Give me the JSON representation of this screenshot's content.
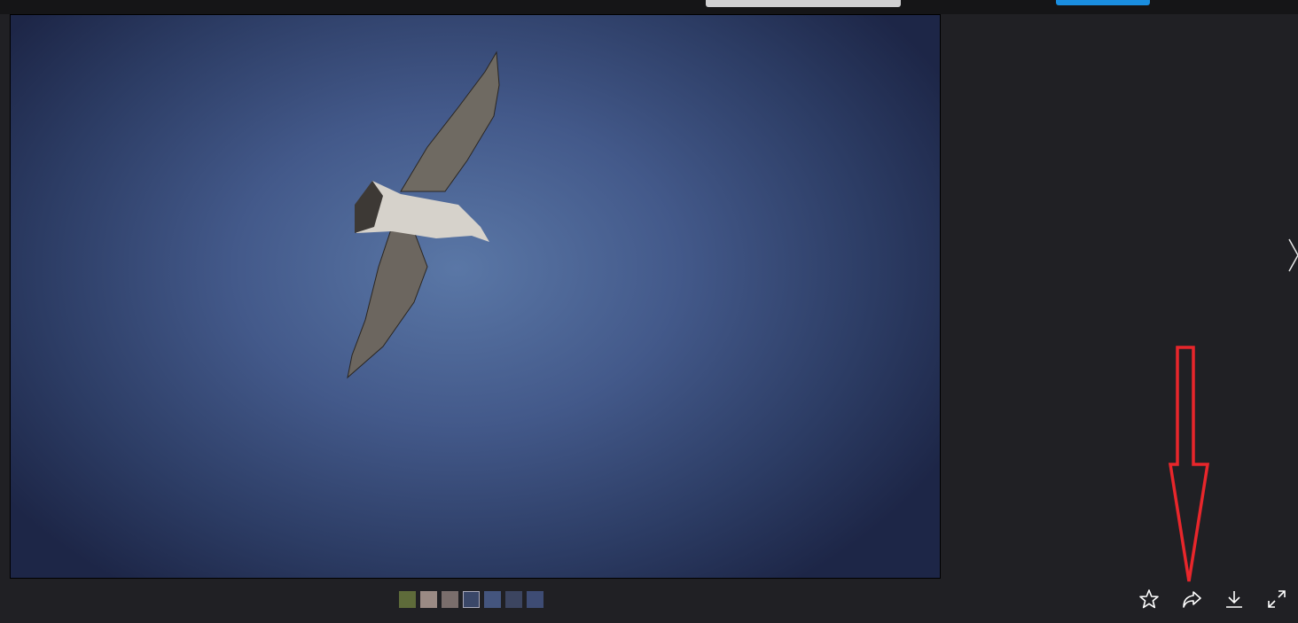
{
  "viewer": {
    "thumbnails": [
      {
        "color": "#5e6b3a"
      },
      {
        "color": "#9a8a84"
      },
      {
        "color": "#7a6e6c"
      },
      {
        "color": "#3a4768",
        "selected": true
      },
      {
        "color": "#44557e"
      },
      {
        "color": "#3c4560"
      },
      {
        "color": "#3e4c74"
      }
    ],
    "actions": [
      "star-icon",
      "share-icon",
      "download-icon",
      "fullscreen-icon"
    ],
    "accent_color": "#1a8ee0",
    "annotation_color": "#e8262b"
  }
}
